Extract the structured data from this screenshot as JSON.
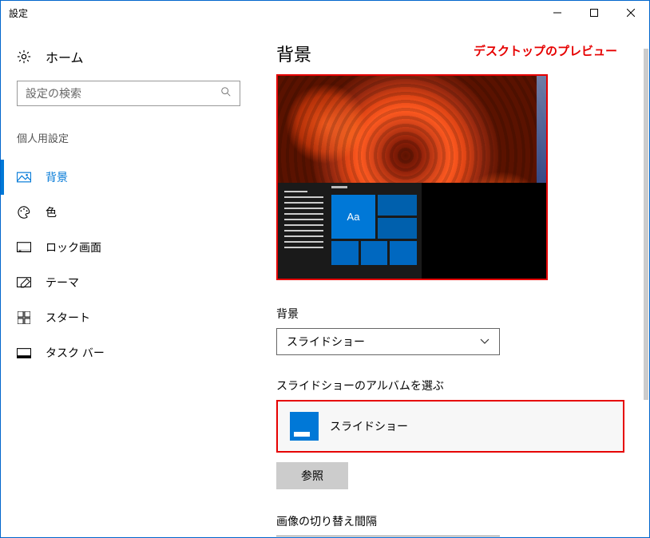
{
  "window": {
    "title": "設定"
  },
  "sidebar": {
    "home": "ホーム",
    "search_placeholder": "設定の検索",
    "section": "個人用設定",
    "items": [
      {
        "label": "背景"
      },
      {
        "label": "色"
      },
      {
        "label": "ロック画面"
      },
      {
        "label": "テーマ"
      },
      {
        "label": "スタート"
      },
      {
        "label": "タスク バー"
      }
    ]
  },
  "main": {
    "title": "背景",
    "annotation": "デスクトップのプレビュー",
    "preview_text": "Aa",
    "bg_label": "背景",
    "bg_value": "スライドショー",
    "album_label": "スライドショーのアルバムを選ぶ",
    "album_value": "スライドショー",
    "browse": "参照",
    "interval_label": "画像の切り替え間隔"
  }
}
